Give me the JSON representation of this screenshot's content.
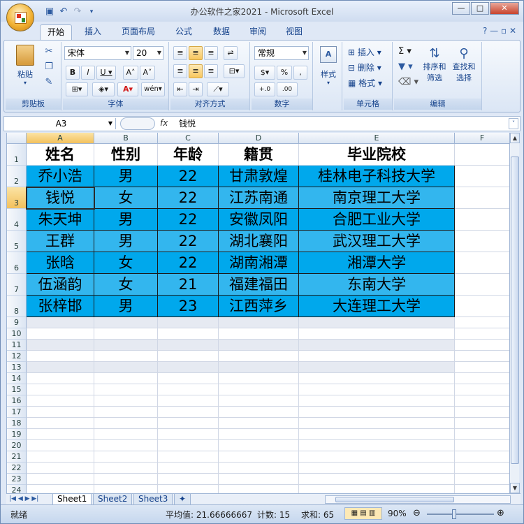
{
  "window": {
    "title": "办公软件之家2021 - Microsoft Excel",
    "controls": [
      "—",
      "□",
      "✕"
    ]
  },
  "ribbon_tabs": [
    "开始",
    "插入",
    "页面布局",
    "公式",
    "数据",
    "审阅",
    "视图"
  ],
  "ribbon": {
    "clipboard": {
      "label": "剪贴板",
      "paste": "粘贴"
    },
    "font": {
      "label": "字体",
      "name": "宋体",
      "size": "20"
    },
    "alignment": {
      "label": "对齐方式"
    },
    "number": {
      "label": "数字",
      "format": "常规"
    },
    "styles": {
      "label": "样式"
    },
    "cells": {
      "label": "单元格",
      "insert": "插入",
      "delete": "删除",
      "format": "格式"
    },
    "editing": {
      "label": "编辑",
      "sort": "排序和",
      "sort2": "筛选",
      "find": "查找和",
      "find2": "选择"
    }
  },
  "formula_bar": {
    "cell_ref": "A3",
    "fx": "fx",
    "content": "钱悦"
  },
  "columns": [
    "A",
    "B",
    "C",
    "D",
    "E",
    "F"
  ],
  "rows": [
    "1",
    "2",
    "3",
    "4",
    "5",
    "6",
    "7",
    "8",
    "9",
    "10",
    "11",
    "12",
    "13",
    "14",
    "15",
    "16",
    "17",
    "18",
    "19",
    "20",
    "21",
    "22",
    "23",
    "24"
  ],
  "table": {
    "headers": [
      "姓名",
      "性别",
      "年龄",
      "籍贯",
      "毕业院校"
    ],
    "rows": [
      [
        "乔小浩",
        "男",
        "22",
        "甘肃敦煌",
        "桂林电子科技大学"
      ],
      [
        "钱悦",
        "女",
        "22",
        "江苏南通",
        "南京理工大学"
      ],
      [
        "朱天坤",
        "男",
        "22",
        "安徽凤阳",
        "合肥工业大学"
      ],
      [
        "王群",
        "男",
        "22",
        "湖北襄阳",
        "武汉理工大学"
      ],
      [
        "张晗",
        "女",
        "22",
        "湖南湘潭",
        "湘潭大学"
      ],
      [
        "伍涵韵",
        "女",
        "21",
        "福建福田",
        "东南大学"
      ],
      [
        "张梓邯",
        "男",
        "23",
        "江西萍乡",
        "大连理工大学"
      ]
    ]
  },
  "colors": {
    "row_dark": "#00a8ec",
    "row_light": "#33b6ee",
    "selected_header": "#f3c15d"
  },
  "sheets": [
    "Sheet1",
    "Sheet2",
    "Sheet3"
  ],
  "status_bar": {
    "mode": "就绪",
    "average": "平均值: 21.66666667",
    "count": "计数: 15",
    "sum": "求和: 65",
    "zoom": "90%"
  }
}
